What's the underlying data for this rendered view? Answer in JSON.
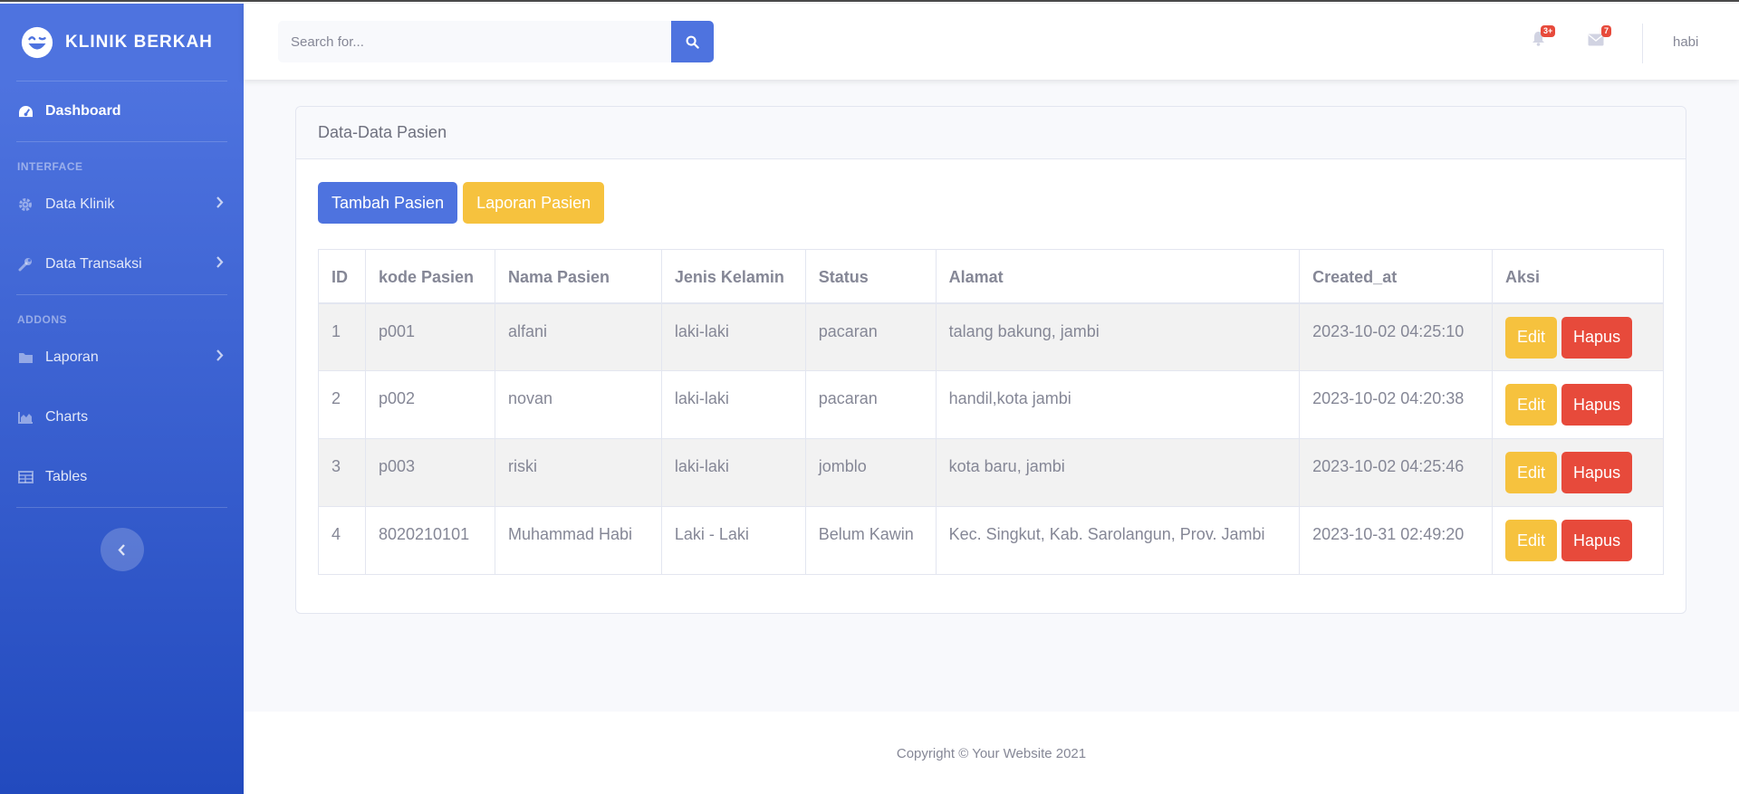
{
  "brand": {
    "name": "KLINIK BERKAH",
    "icon": "laugh-wink-icon"
  },
  "sidebar": {
    "dashboard": {
      "label": "Dashboard",
      "icon": "tachometer-icon"
    },
    "heading_interface": "Interface",
    "data_klinik": {
      "label": "Data Klinik",
      "icon": "cog-icon"
    },
    "data_transaksi": {
      "label": "Data Transaksi",
      "icon": "wrench-icon"
    },
    "heading_addons": "Addons",
    "laporan": {
      "label": "Laporan",
      "icon": "folder-icon"
    },
    "charts": {
      "label": "Charts",
      "icon": "chart-area-icon"
    },
    "tables": {
      "label": "Tables",
      "icon": "table-icon"
    }
  },
  "topbar": {
    "search_placeholder": "Search for...",
    "alerts_badge": "3+",
    "messages_badge": "7",
    "username": "habi"
  },
  "card": {
    "title": "Data-Data Pasien",
    "add_button": "Tambah Pasien",
    "report_button": "Laporan Pasien"
  },
  "table": {
    "headers": [
      "ID",
      "kode Pasien",
      "Nama Pasien",
      "Jenis Kelamin",
      "Status",
      "Alamat",
      "Created_at",
      "Aksi"
    ],
    "rows": [
      [
        "1",
        "p001",
        "alfani",
        "laki-laki",
        "pacaran",
        "talang bakung, jambi",
        "2023-10-02 04:25:10"
      ],
      [
        "2",
        "p002",
        "novan",
        "laki-laki",
        "pacaran",
        "handil,kota jambi",
        "2023-10-02 04:20:38"
      ],
      [
        "3",
        "p003",
        "riski",
        "laki-laki",
        "jomblo",
        "kota baru, jambi",
        "2023-10-02 04:25:46"
      ],
      [
        "4",
        "8020210101",
        "Muhammad Habi",
        "Laki - Laki",
        "Belum Kawin",
        "Kec. Singkut, Kab. Sarolangun, Prov. Jambi",
        "2023-10-31 02:49:20"
      ]
    ],
    "edit_label": "Edit",
    "delete_label": "Hapus"
  },
  "footer": {
    "copyright": "Copyright © Your Website 2021"
  },
  "colors": {
    "primary": "#4e73df",
    "warning": "#f6c23e",
    "danger": "#e74a3b"
  }
}
